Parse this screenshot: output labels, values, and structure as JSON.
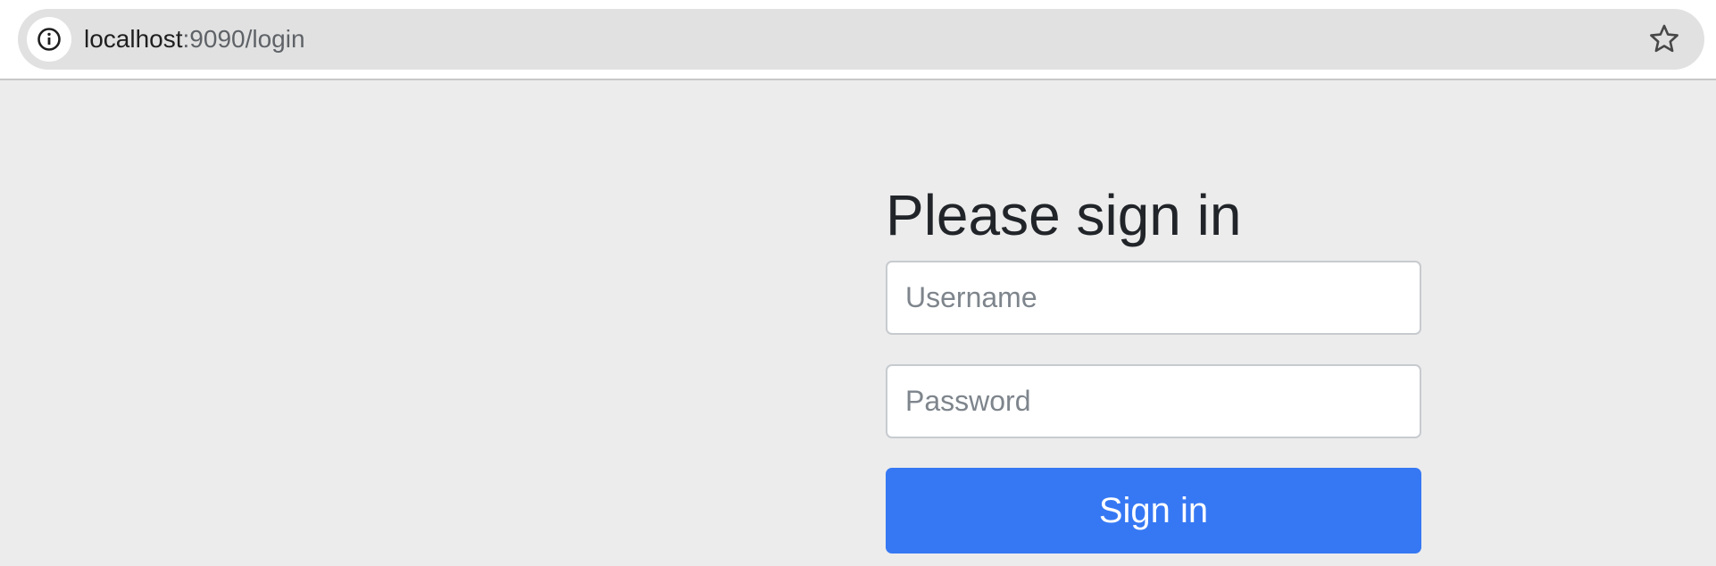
{
  "browser": {
    "url_host": "localhost",
    "url_rest": ":9090/login",
    "site_info_icon": "info-circle-icon",
    "bookmark_icon": "star-outline-icon"
  },
  "login_form": {
    "heading": "Please sign in",
    "username": {
      "value": "",
      "placeholder": "Username"
    },
    "password": {
      "value": "",
      "placeholder": "Password"
    },
    "submit_label": "Sign in"
  },
  "colors": {
    "page_background": "#ececec",
    "primary_button": "#3678f4",
    "heading_text": "#212529",
    "placeholder_text": "#7e858c",
    "address_bar": "#e1e1e1"
  }
}
